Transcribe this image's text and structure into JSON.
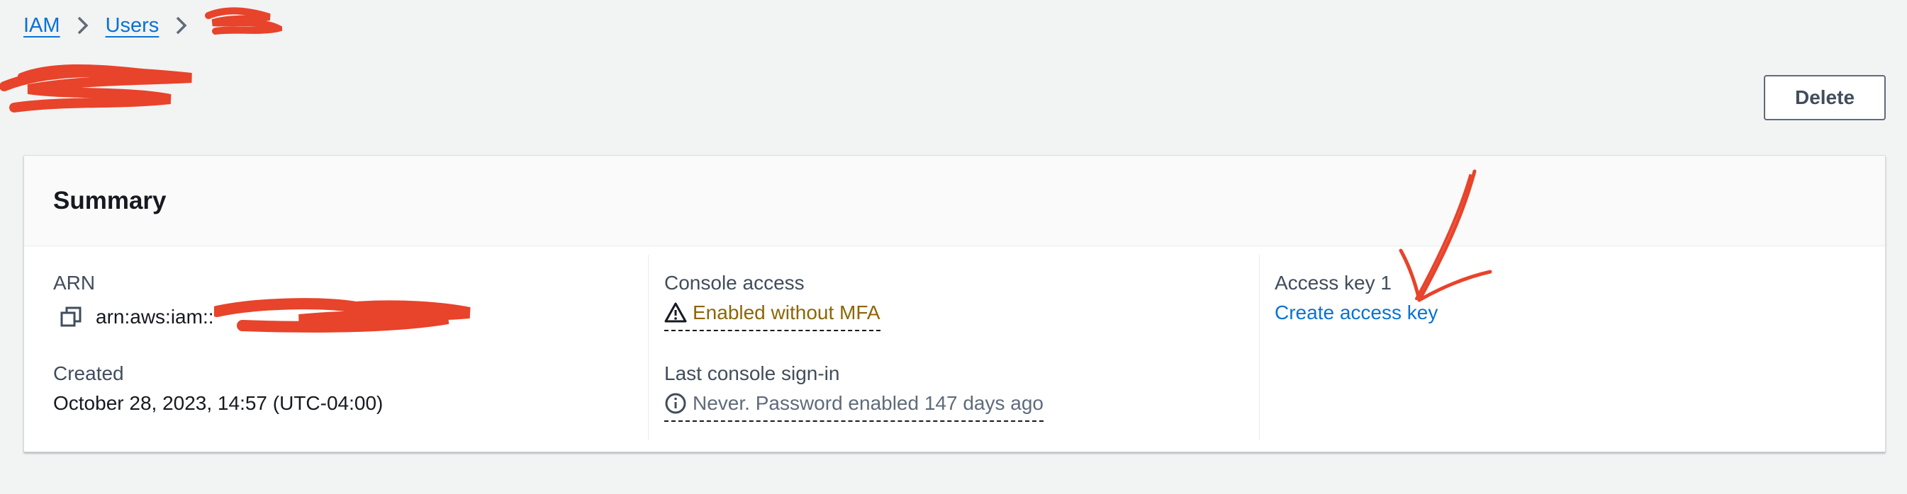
{
  "breadcrumb": {
    "items": [
      "IAM",
      "Users"
    ]
  },
  "header": {
    "delete_label": "Delete"
  },
  "summary": {
    "title": "Summary",
    "arn_label": "ARN",
    "arn_value": "arn:aws:iam::",
    "created_label": "Created",
    "created_value": "October 28, 2023, 14:57 (UTC-04:00)",
    "console_access_label": "Console access",
    "console_access_value": "Enabled without MFA",
    "last_signin_label": "Last console sign-in",
    "last_signin_value": "Never. Password enabled 147 days ago",
    "access_key_label": "Access key 1",
    "access_key_link": "Create access key"
  },
  "colors": {
    "link": "#0972d3",
    "warning": "#8d6605",
    "muted": "#5f6b7a",
    "annotation": "#e8432b"
  },
  "icons": [
    "chevron-right-icon",
    "copy-icon",
    "warning-icon",
    "info-icon"
  ]
}
